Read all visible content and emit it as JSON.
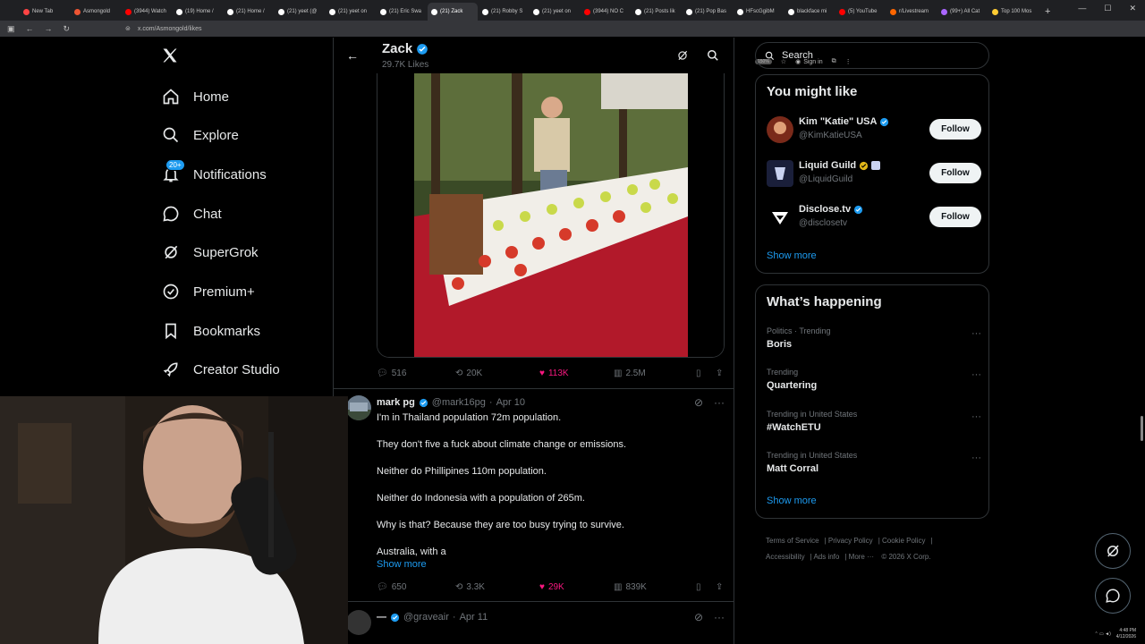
{
  "browser": {
    "tabs": [
      {
        "label": "New Tab",
        "color": "#f44"
      },
      {
        "label": "Asmongold",
        "color": "#e53"
      },
      {
        "label": "(3944) Watch",
        "color": "#f00"
      },
      {
        "label": "(19) Home /",
        "color": "#fff"
      },
      {
        "label": "(21) Home /",
        "color": "#fff"
      },
      {
        "label": "(21) yeet (@",
        "color": "#fff"
      },
      {
        "label": "(21) yeet on",
        "color": "#fff"
      },
      {
        "label": "(21) Eric Swa",
        "color": "#fff"
      },
      {
        "label": "(21) Zack",
        "color": "#fff",
        "active": true
      },
      {
        "label": "(21) Robby S",
        "color": "#fff"
      },
      {
        "label": "(21) yeet on",
        "color": "#fff"
      },
      {
        "label": "(3944) NO C",
        "color": "#f00"
      },
      {
        "label": "(21) Posts lik",
        "color": "#fff"
      },
      {
        "label": "(21) Pop Bas",
        "color": "#fff"
      },
      {
        "label": "HFscGgibM",
        "color": "#fff"
      },
      {
        "label": "blackface mi",
        "color": "#fff"
      },
      {
        "label": "(5) YouTube",
        "color": "#f00"
      },
      {
        "label": "r/Livestream",
        "color": "#f60"
      },
      {
        "label": "(99+) All Cat",
        "color": "#a6f"
      },
      {
        "label": "Top 100 Mos",
        "color": "#fc3"
      }
    ],
    "url": "x.com/Asmongold/likes",
    "zoom": "150%",
    "signin": "Sign in"
  },
  "nav": {
    "items": [
      {
        "label": "Home",
        "icon": "home-icon"
      },
      {
        "label": "Explore",
        "icon": "search-icon"
      },
      {
        "label": "Notifications",
        "icon": "bell-icon",
        "badge": "20+"
      },
      {
        "label": "Chat",
        "icon": "chat-icon"
      },
      {
        "label": "SuperGrok",
        "icon": "grok-icon"
      },
      {
        "label": "Premium+",
        "icon": "premium-icon"
      },
      {
        "label": "Bookmarks",
        "icon": "bookmark-icon"
      },
      {
        "label": "Creator Studio",
        "icon": "rocket-icon"
      }
    ]
  },
  "header": {
    "name": "Zack",
    "likes": "29.7K Likes"
  },
  "post1": {
    "replies": "516",
    "reposts": "20K",
    "likes": "113K",
    "views": "2.5M"
  },
  "post2": {
    "name": "mark pg",
    "handle": "@mark16pg",
    "date": "Apr 10",
    "lines": [
      "I'm in Thailand population 72m population.",
      "They don't five a fuck about climate change or emissions.",
      "Neither do Phillipines 110m population.",
      "Neither do Indonesia with a population of 265m.",
      "Why is that? Because they are too busy trying to survive.",
      "Australia, with a"
    ],
    "show_more": "Show more",
    "replies": "650",
    "reposts": "3.3K",
    "likes": "29K",
    "views": "839K"
  },
  "post3": {
    "name": "—",
    "handle": "@graveair",
    "date": "Apr 11"
  },
  "right": {
    "search_placeholder": "Search",
    "you_might_like": "You might like",
    "suggestions": [
      {
        "name": "Kim \"Katie\" USA",
        "handle": "@KimKatieUSA",
        "follow": "Follow"
      },
      {
        "name": "Liquid Guild",
        "handle": "@LiquidGuild",
        "follow": "Follow"
      },
      {
        "name": "Disclose.tv",
        "handle": "@disclosetv",
        "follow": "Follow"
      }
    ],
    "show_more": "Show more",
    "whats_happening": "What’s happening",
    "trends": [
      {
        "context": "Politics · Trending",
        "title": "Boris"
      },
      {
        "context": "Trending",
        "title": "Quartering"
      },
      {
        "context": "Trending in United States",
        "title": "#WatchETU"
      },
      {
        "context": "Trending in United States",
        "title": "Matt Corral"
      }
    ],
    "show_more2": "Show more",
    "footer": [
      "Terms of Service",
      "Privacy Policy",
      "Cookie Policy",
      "Accessibility",
      "Ads info",
      "More ···",
      "© 2026 X Corp."
    ]
  },
  "taskbar": {
    "time": "4:48 PM",
    "date": "4/12/2026"
  },
  "colors": {
    "accent": "#1d9bf0",
    "like": "#f91880",
    "verified": "#1d9bf0",
    "gold": "#e2b719"
  }
}
